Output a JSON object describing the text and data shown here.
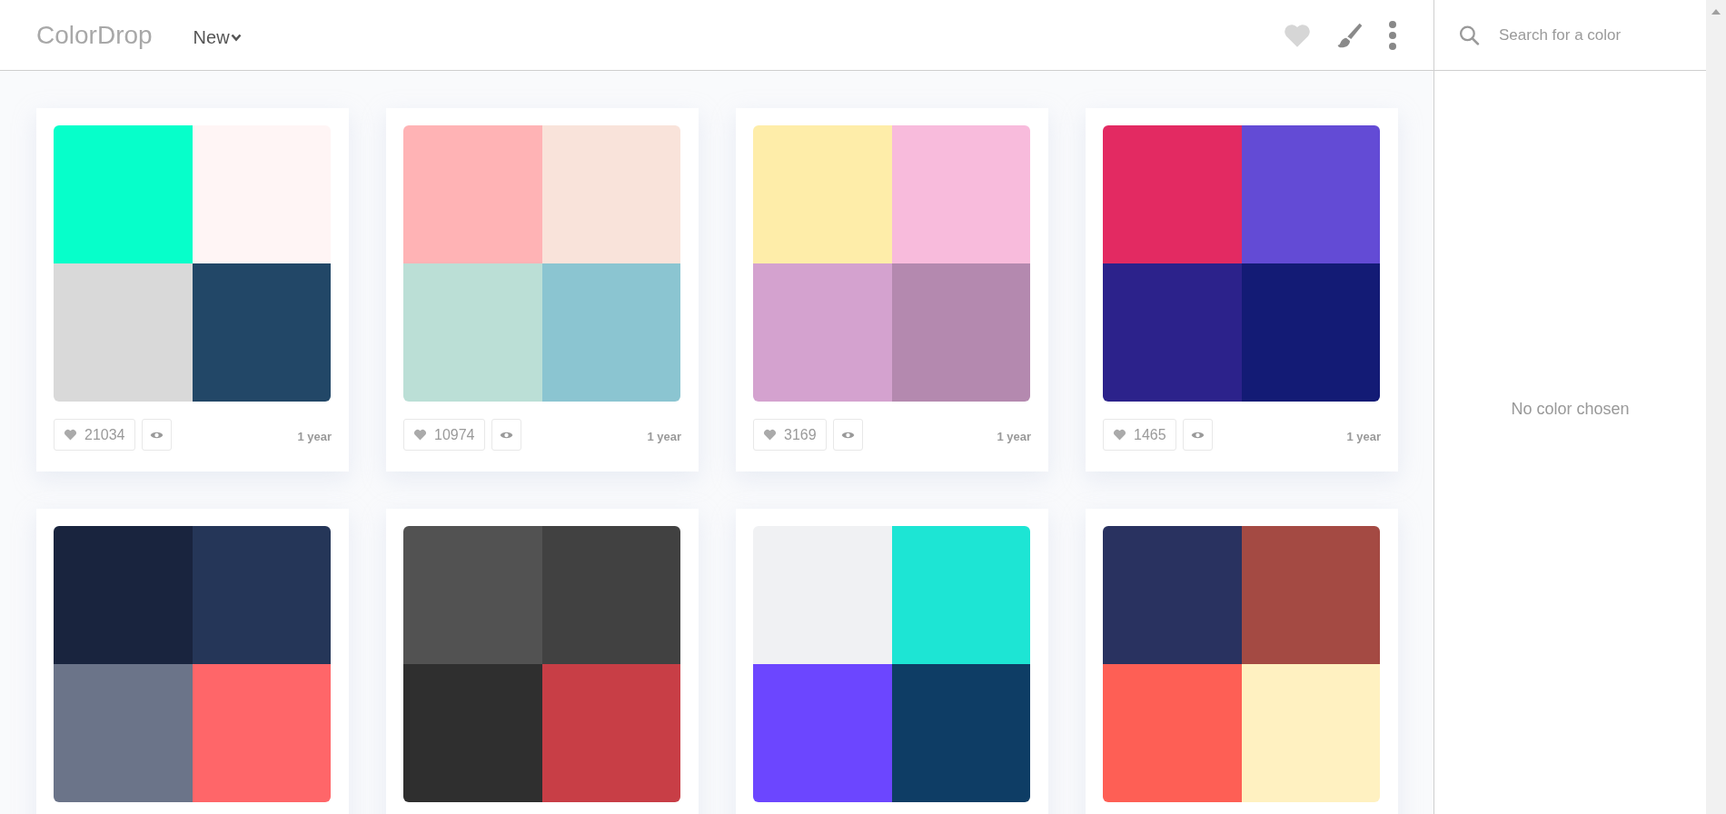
{
  "header": {
    "logo": "ColorDrop",
    "sort_menu": {
      "label": "New"
    }
  },
  "search": {
    "placeholder": "Search for a color"
  },
  "sidebar": {
    "empty_message": "No color chosen"
  },
  "palettes": [
    {
      "colors": [
        {
          "color": "#06ffca"
        },
        {
          "color": "#fff5f5"
        },
        {
          "color": "#d9d9d9"
        },
        {
          "color": "#224767"
        }
      ],
      "likes": "21034",
      "age": "1 year"
    },
    {
      "colors": [
        {
          "color": "#ffb3b5"
        },
        {
          "color": "#f9e3da"
        },
        {
          "color": "#bbdfd6"
        },
        {
          "color": "#8bc5d1"
        }
      ],
      "likes": "10974",
      "age": "1 year"
    },
    {
      "colors": [
        {
          "color": "#feeda9"
        },
        {
          "color": "#f8bbdc"
        },
        {
          "color": "#d4a2cf"
        },
        {
          "color": "#b489af"
        }
      ],
      "likes": "3169",
      "age": "1 year"
    },
    {
      "colors": [
        {
          "color": "#e32a62"
        },
        {
          "color": "#634bd5"
        },
        {
          "color": "#2c228b"
        },
        {
          "color": "#131b75"
        }
      ],
      "likes": "1465",
      "age": "1 year"
    },
    {
      "colors": [
        {
          "color": "#19243e"
        },
        {
          "color": "#253658"
        },
        {
          "color": "#6b7489"
        },
        {
          "color": "#ff6669"
        }
      ]
    },
    {
      "colors": [
        {
          "color": "#525252"
        },
        {
          "color": "#414141"
        },
        {
          "color": "#2f2f2f"
        },
        {
          "color": "#c83e46"
        }
      ]
    },
    {
      "colors": [
        {
          "color": "#f0f1f3"
        },
        {
          "color": "#1de5d4"
        },
        {
          "color": "#6c46ff"
        },
        {
          "color": "#0e3d65"
        }
      ]
    },
    {
      "colors": [
        {
          "color": "#293260"
        },
        {
          "color": "#a44a43"
        },
        {
          "color": "#fe5f55"
        },
        {
          "color": "#fff1c1"
        }
      ]
    }
  ]
}
